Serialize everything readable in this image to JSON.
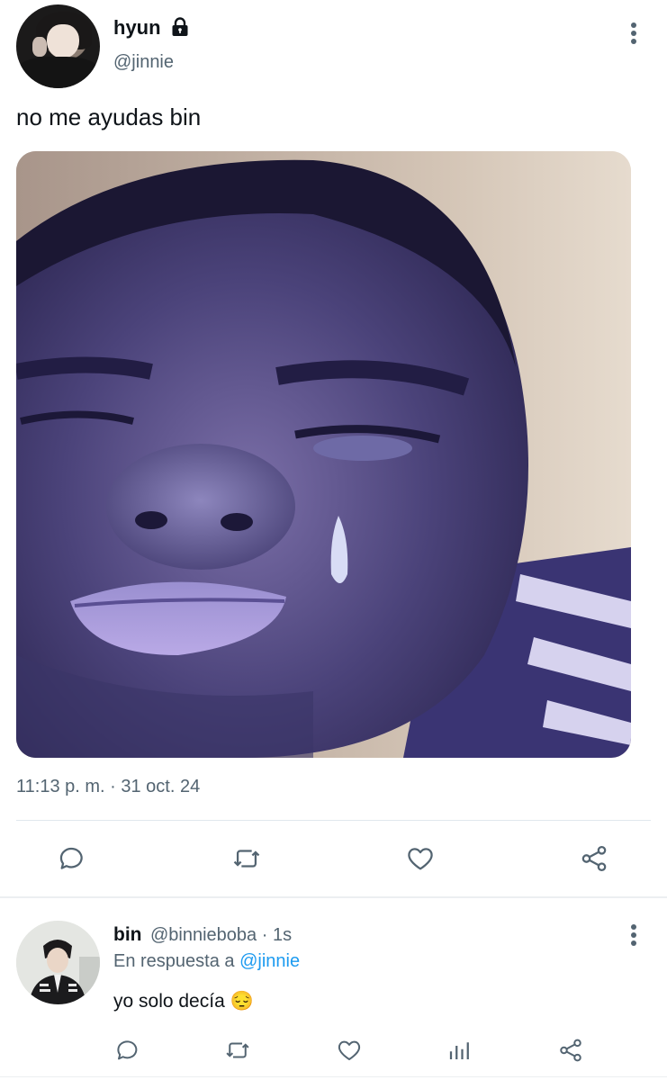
{
  "tweet": {
    "author_name": "hyun",
    "author_handle": "@jinnie",
    "text": "no me ayudas bin",
    "timestamp": "11:13 p. m. · 31 oct. 24",
    "icons": {
      "lock": "lock-icon",
      "more": "more-icon",
      "reply": "reply-icon",
      "retweet": "retweet-icon",
      "like": "heart-icon",
      "share": "share-icon"
    }
  },
  "reply": {
    "author_name": "bin",
    "meta": "@binnieboba · 1s",
    "in_reply_prefix": "En respuesta a",
    "in_reply_mention": "@jinnie",
    "text": "yo solo decía 😔",
    "icons": {
      "reply": "reply-icon",
      "retweet": "retweet-icon",
      "like": "heart-icon",
      "stats": "stats-icon",
      "share": "share-icon",
      "more": "more-icon"
    }
  },
  "colors": {
    "text": "#0f1419",
    "muted": "#536471",
    "link": "#1d9bf0",
    "icon": "#536471"
  }
}
